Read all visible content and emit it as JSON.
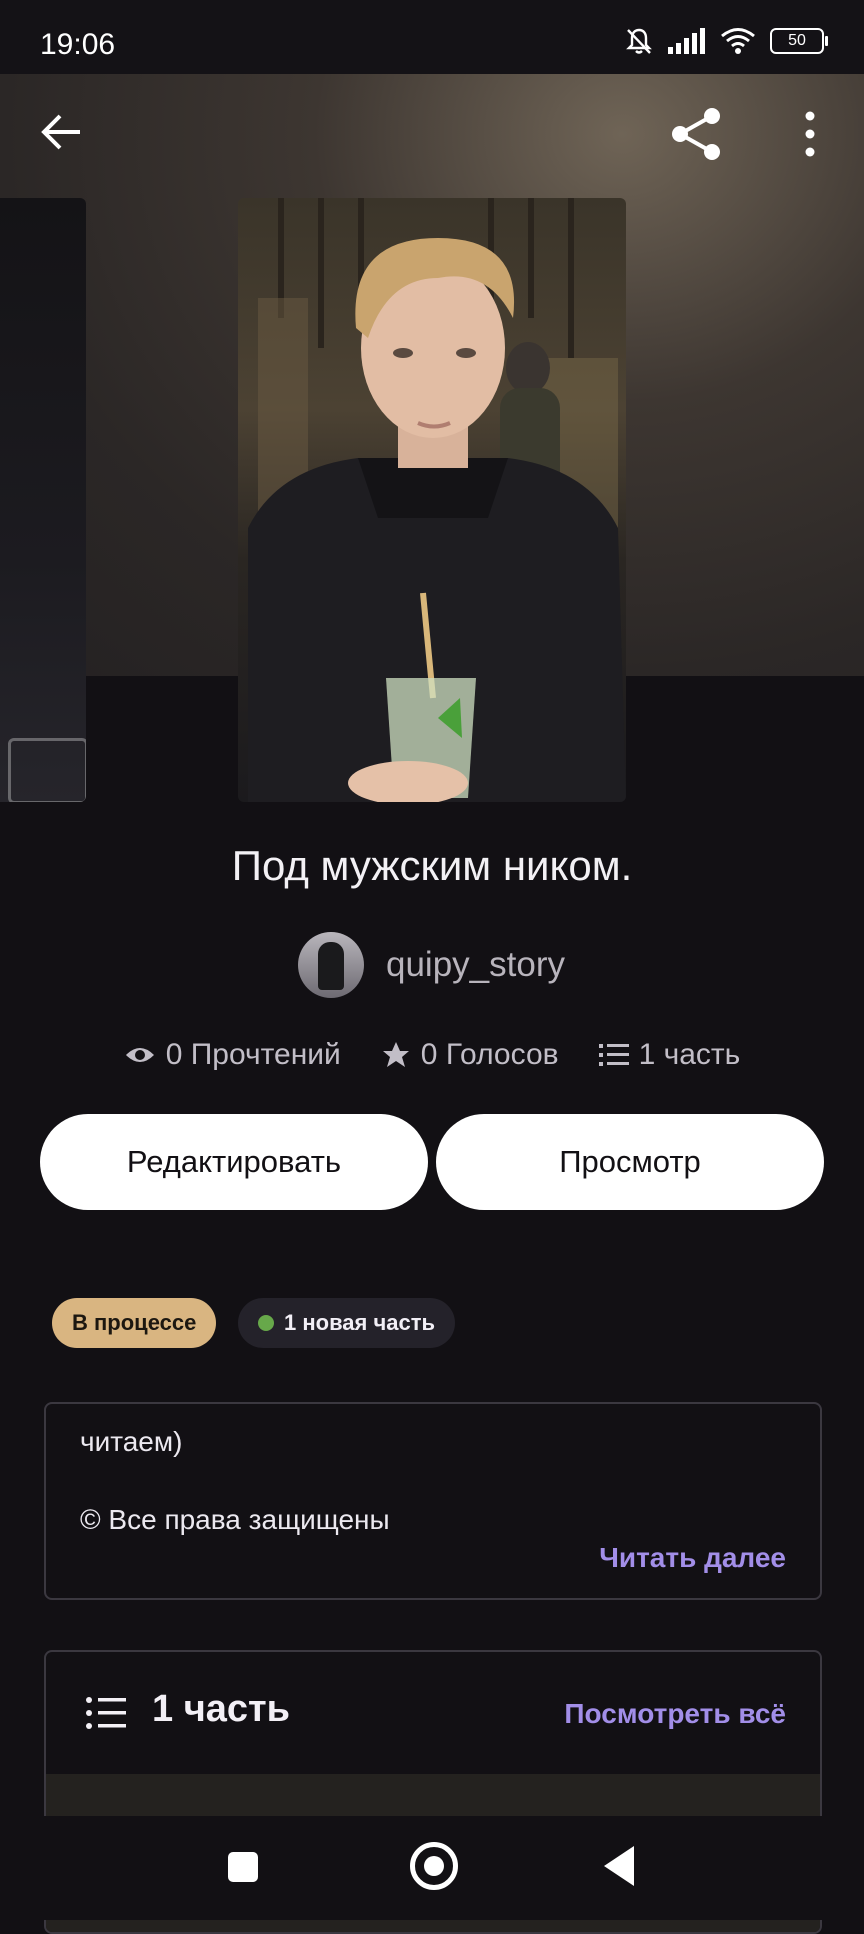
{
  "status_bar": {
    "time": "19:06",
    "battery": "50",
    "icons": [
      "bell-muted-icon",
      "signal-icon",
      "wifi-icon",
      "battery-icon"
    ]
  },
  "top_bar": {
    "icons": [
      "back-arrow-icon",
      "share-icon",
      "more-vertical-icon"
    ]
  },
  "story": {
    "title": "Под мужским ником.",
    "author": "quipy_story",
    "stats": {
      "reads": "0 Прочтений",
      "votes": "0 Голосов",
      "parts": "1 часть"
    }
  },
  "actions": {
    "edit": "Редактировать",
    "view": "Просмотр"
  },
  "tags": {
    "status": "В процессе",
    "new_parts": "1 новая часть"
  },
  "description": {
    "line1": "читаем)",
    "line2": "© Все права защищены",
    "read_more": "Читать далее"
  },
  "parts_section": {
    "title": "1 часть",
    "see_all": "Посмотреть всё"
  },
  "colors": {
    "background": "#121014",
    "accent": "#a28ee8",
    "status_tag": "#d9b581",
    "new_dot": "#67a84a"
  }
}
